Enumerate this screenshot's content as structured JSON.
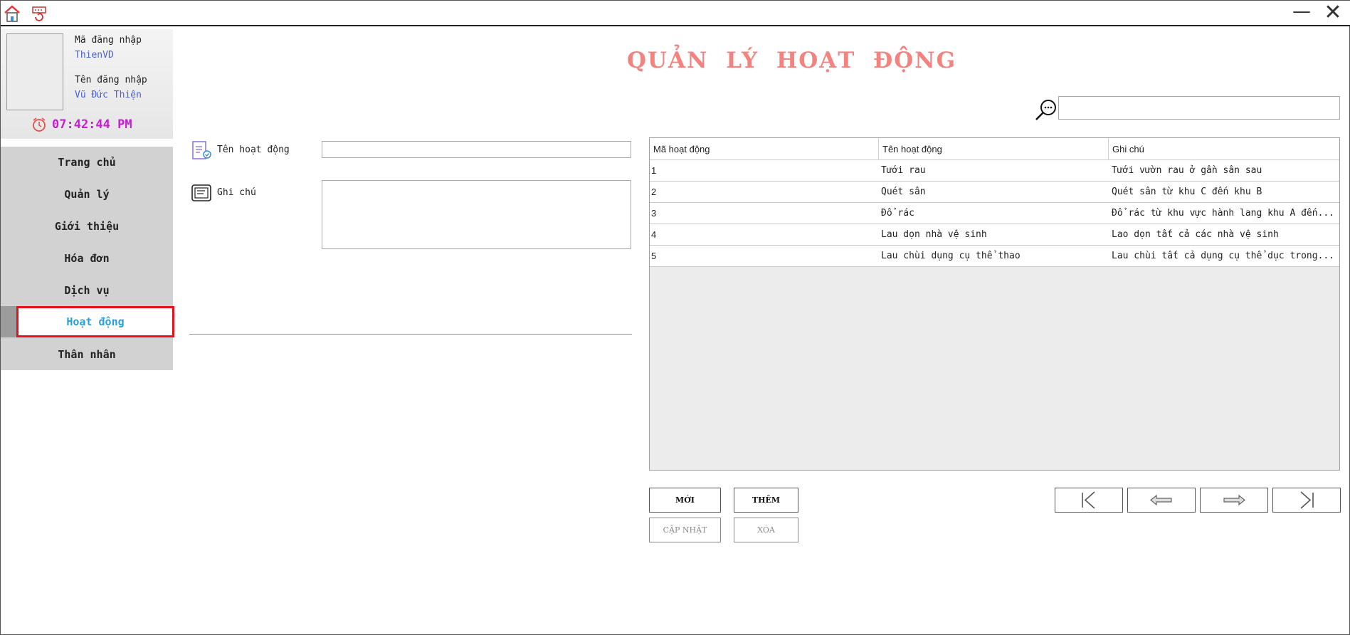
{
  "titlebar": {
    "home_icon": "home-icon",
    "refresh_icon": "refresh-icon",
    "minimize_label": "—",
    "close_label": "✕"
  },
  "profile": {
    "login_id_label": "Mã đăng nhập",
    "login_id_value": "ThienVD",
    "login_name_label": "Tên đăng nhập",
    "login_name_value": "Vũ Đức Thiện",
    "clock": "07:42:44 PM"
  },
  "nav": {
    "items": [
      {
        "label": "Trang chủ"
      },
      {
        "label": "Quản lý"
      },
      {
        "label": "Giới thiệu"
      },
      {
        "label": "Hóa đơn"
      },
      {
        "label": "Dịch vụ"
      },
      {
        "label": "Hoạt động"
      },
      {
        "label": "Thân nhân"
      }
    ],
    "active_index": 5
  },
  "main": {
    "title": "QUẢN LÝ HOẠT ĐỘNG",
    "search": {
      "value": "",
      "placeholder": ""
    },
    "form": {
      "name_label": "Tên hoạt động",
      "name_value": "",
      "note_label": "Ghi chú",
      "note_value": ""
    },
    "table": {
      "columns": [
        "Mã hoạt động",
        "Tên hoạt động",
        "Ghi chú"
      ],
      "rows": [
        [
          "1",
          "Tưới rau",
          "Tưới vườn rau ở gần sân sau"
        ],
        [
          "2",
          "Quét sân",
          "Quét sân từ khu C đến khu B"
        ],
        [
          "3",
          "Đổ rác",
          "Đổ rác từ khu vực hành lang khu A đến..."
        ],
        [
          "4",
          "Lau dọn nhà vệ sinh",
          "Lao dọn tất cả các nhà vệ sinh"
        ],
        [
          "5",
          "Lau chùi dụng cụ thể thao",
          "Lau chùi tất cả dụng cụ thể dục trong..."
        ]
      ]
    },
    "buttons": {
      "new": "MỚI",
      "add": "THÊM",
      "update": "CẬP NHẬT",
      "delete": "XÓA"
    },
    "pager": {
      "first_icon": "first-page-icon",
      "prev_icon": "previous-arrow-icon",
      "next_icon": "next-arrow-icon",
      "last_icon": "last-page-icon"
    }
  },
  "colors": {
    "title": "#f3837f",
    "clock": "#c61ed2",
    "profile_value": "#4a5fd0",
    "active_nav_text": "#2a9fe0",
    "active_nav_border": "#e8101a",
    "nav_bg": "#d2d2d2"
  }
}
